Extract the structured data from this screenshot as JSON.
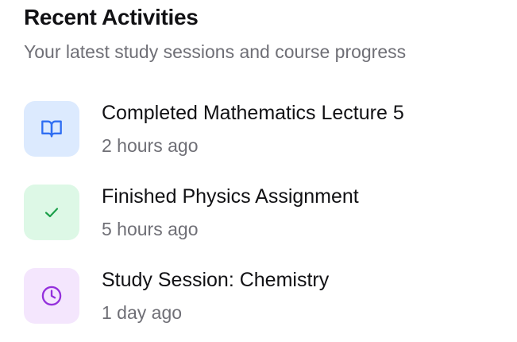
{
  "header": {
    "title": "Recent Activities",
    "subtitle": "Your latest study sessions and course progress"
  },
  "activities": [
    {
      "title": "Completed Mathematics Lecture 5",
      "time": "2 hours ago",
      "icon": "book-icon",
      "icon_bg": "#dceafe",
      "icon_color": "#2f6ef2"
    },
    {
      "title": "Finished Physics Assignment",
      "time": "5 hours ago",
      "icon": "check-icon",
      "icon_bg": "#ddf8e6",
      "icon_color": "#1c9f4a"
    },
    {
      "title": "Study Session: Chemistry",
      "time": "1 day ago",
      "icon": "clock-icon",
      "icon_bg": "#f4e6fd",
      "icon_color": "#9430dc"
    }
  ]
}
